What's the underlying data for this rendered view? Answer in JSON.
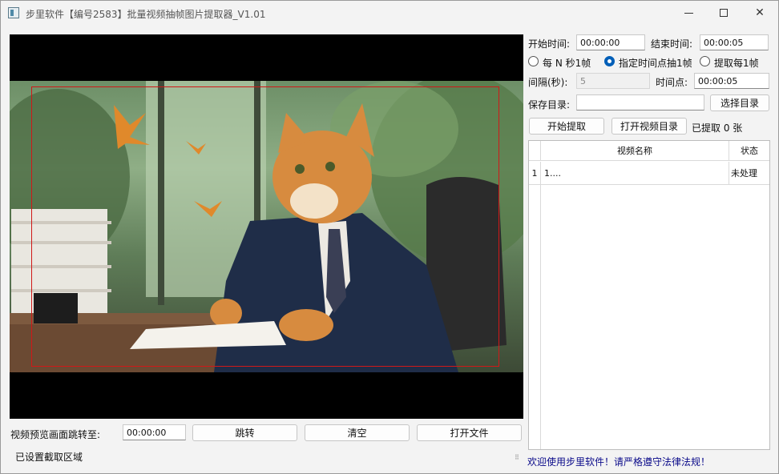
{
  "window": {
    "title": "步里软件【编号2583】批量视频抽帧图片提取器_V1.01",
    "minimize_icon": "minimize-icon",
    "maximize_icon": "maximize-icon",
    "close_icon": "close-icon"
  },
  "preview": {
    "jump_label": "视频预览画面跳转至:",
    "jump_time": "00:00:00",
    "jump_button": "跳转",
    "clear_button": "清空",
    "open_file_button": "打开文件",
    "status": "已设置截取区域"
  },
  "settings": {
    "start_label": "开始时间:",
    "start_value": "00:00:00",
    "end_label": "结束时间:",
    "end_value": "00:00:05",
    "mode_options": [
      {
        "label": "每 N 秒1帧",
        "checked": false
      },
      {
        "label": "指定时间点抽1帧",
        "checked": true
      },
      {
        "label": "提取每1帧",
        "checked": false
      }
    ],
    "interval_label": "间隔(秒):",
    "interval_value": "5",
    "timepoint_label": "时间点:",
    "timepoint_value": "00:00:05",
    "save_dir_label": "保存目录:",
    "save_dir_value": "",
    "choose_dir_button": "选择目录",
    "start_extract_button": "开始提取",
    "open_video_dir_button": "打开视频目录",
    "extracted_count": "已提取 0 张"
  },
  "table": {
    "columns": [
      "视频名称",
      "状态"
    ],
    "rows": [
      {
        "index": "1",
        "name": "1....",
        "status": "未处理"
      }
    ]
  },
  "footer": {
    "message": "欢迎使用步里软件！请严格遵守法律法规！"
  }
}
